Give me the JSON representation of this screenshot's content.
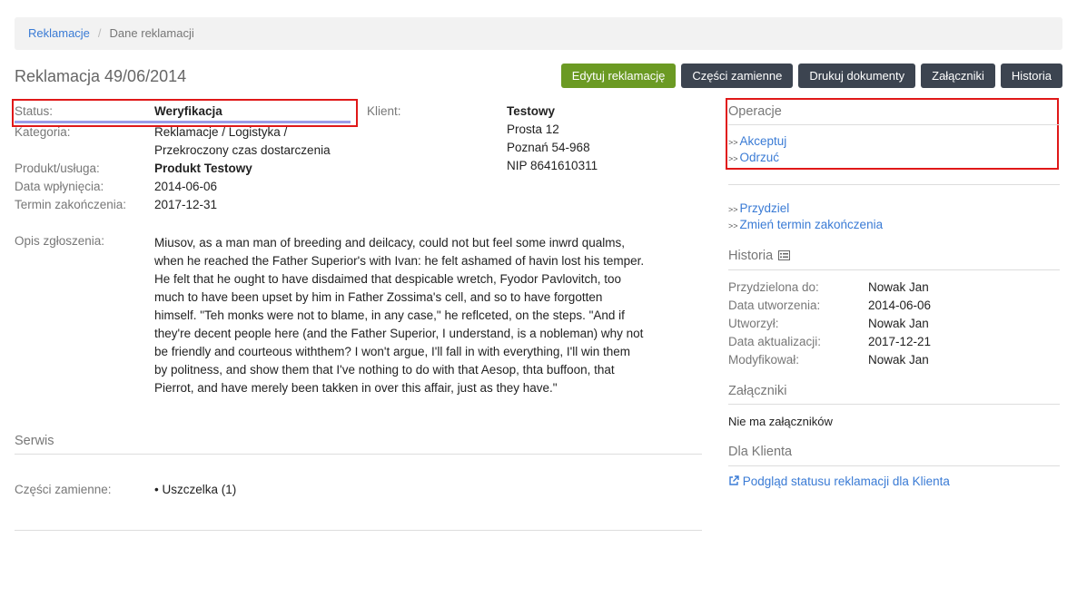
{
  "breadcrumb": {
    "items": [
      {
        "label": "Reklamacje"
      },
      {
        "label": "Dane reklamacji"
      }
    ]
  },
  "title": "Reklamacja 49/06/2014",
  "buttons": [
    {
      "label": "Edytuj reklamację"
    },
    {
      "label": "Części zamienne"
    },
    {
      "label": "Drukuj dokumenty"
    },
    {
      "label": "Załączniki"
    },
    {
      "label": "Historia"
    }
  ],
  "details": {
    "status_label": "Status:",
    "status_value": "Weryfikacja",
    "kategoria_label": "Kategoria:",
    "kategoria_line1": "Reklamacje / Logistyka /",
    "kategoria_line2": "Przekroczony czas dostarczenia",
    "produkt_label": "Produkt/usługa:",
    "produkt_value": "Produkt Testowy",
    "data_label": "Data wpłynięcia:",
    "data_value": "2014-06-06",
    "termin_label": "Termin zakończenia:",
    "termin_value": "2017-12-31",
    "opis_label": "Opis zgłoszenia:",
    "opis_value": "Miusov, as a man man of breeding and deilcacy, could not but feel some inwrd qualms, when he reached the Father Superior's with Ivan: he felt ashamed of havin lost his temper. He felt that he ought to have disdaimed that despicable wretch, Fyodor Pavlovitch, too much to have been upset by him in Father Zossima's cell, and so to have forgotten himself. \"Teh monks were not to blame, in any case,\" he reflceted, on the steps. \"And if they're decent people here (and the Father Superior, I understand, is a nobleman) why not be friendly and courteous withthem? I won't argue, I'll fall in with everything, I'll win them by politness, and show them that I've nothing to do with that Aesop, thta buffoon, that Pierrot, and have merely been takken in over this affair, just as they have.\""
  },
  "client": {
    "label": "Klient:",
    "name": "Testowy",
    "street": "Prosta 12",
    "city": "Poznań 54-968",
    "nip": "NIP 8641610311"
  },
  "serwis": {
    "heading": "Serwis",
    "czesci_label": "Części zamienne:",
    "czesci_item": "Uszczelka (1)"
  },
  "sidebar": {
    "operacje_heading": "Operacje",
    "ops": [
      {
        "label": "Akceptuj"
      },
      {
        "label": "Odrzuć"
      }
    ],
    "ops2": [
      {
        "label": "Przydziel"
      },
      {
        "label": "Zmień termin zakończenia"
      }
    ],
    "historia_heading": "Historia",
    "historia": [
      {
        "label": "Przydzielona do:",
        "value": "Nowak Jan"
      },
      {
        "label": "Data utworzenia:",
        "value": "2014-06-06"
      },
      {
        "label": "Utworzył:",
        "value": "Nowak Jan"
      },
      {
        "label": "Data aktualizacji:",
        "value": "2017-12-21"
      },
      {
        "label": "Modyfikował:",
        "value": "Nowak Jan"
      }
    ],
    "zalaczniki_heading": "Załączniki",
    "zalaczniki_text": "Nie ma załączników",
    "dla_klienta_heading": "Dla Klienta",
    "podglad_link": "Podgląd statusu reklamacji dla Klienta"
  }
}
